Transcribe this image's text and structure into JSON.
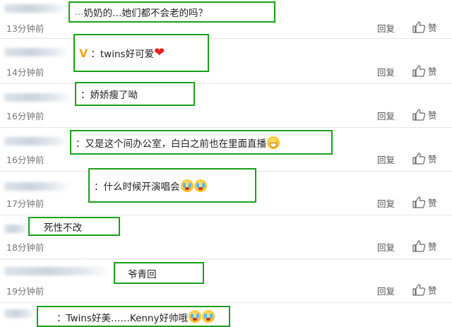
{
  "comments": [
    {
      "prefix": "…",
      "text": "奶奶的…她们都不会老的吗？",
      "time": "13分钟前"
    },
    {
      "badge": "V",
      "text": "：twins好可爱",
      "time": "14分钟前"
    },
    {
      "text": "：娇娇瘦了呦",
      "time": "16分钟前"
    },
    {
      "text": "：又是这个间办公室，白白之前也在里面直播",
      "time": "16分钟前"
    },
    {
      "text": "：什么时候开演唱会",
      "time": "17分钟前"
    },
    {
      "text": "死性不改",
      "time": "18分钟前"
    },
    {
      "text": "爷青回",
      "time": "19分钟前"
    },
    {
      "text": "：Twins好美……Kenny好帅哦"
    }
  ],
  "actions": {
    "reply_label": "回复",
    "like_label": "赞"
  },
  "colors": {
    "highlight_border": "#1aa01a",
    "emoji": "#ffc52c",
    "heart": "#e8201f"
  }
}
